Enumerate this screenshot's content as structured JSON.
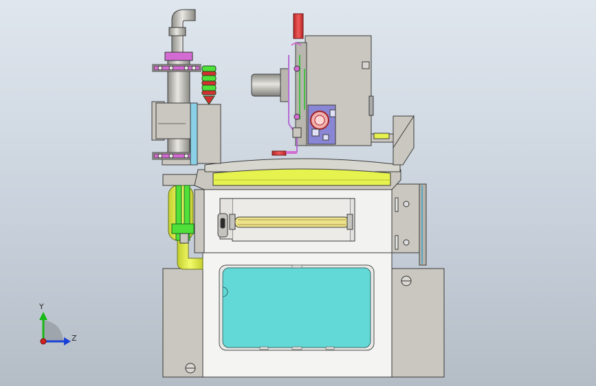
{
  "axes": {
    "y_label": "Y",
    "z_label": "Z"
  },
  "colors": {
    "background_top": "#dfe6ee",
    "background_bottom": "#b4bcc6",
    "housing": "#c9c7bf",
    "housing_dark": "#a9a7a0",
    "window": "#62d9d6",
    "lime": "#e6f24d",
    "green_pipe": "#4fe03a",
    "red_pipe": "#e03a3a",
    "flange": "#d36bd3",
    "panel_blue": "#8a86d6",
    "axis_y": "#18b818",
    "axis_z": "#1a3fd6",
    "axis_origin": "#d42020"
  }
}
